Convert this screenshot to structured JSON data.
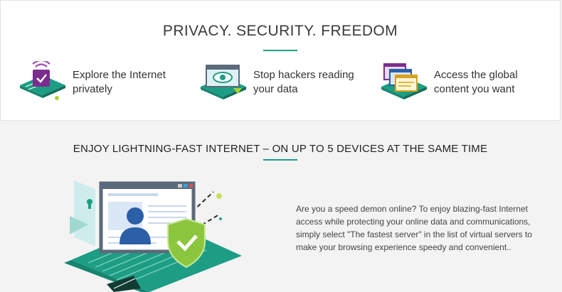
{
  "privacy_section": {
    "heading": "PRIVACY. SECURITY. FREEDOM",
    "features": [
      {
        "icon": "wifi-shield-laptop-icon",
        "text": "Explore the Internet privately"
      },
      {
        "icon": "eye-monitor-icon",
        "text": "Stop hackers reading your data"
      },
      {
        "icon": "stacked-windows-icon",
        "text": "Access the global content you want"
      }
    ]
  },
  "speed_section": {
    "heading": "ENJOY LIGHTNING-FAST INTERNET – ON UP TO 5 DEVICES AT THE SAME TIME",
    "description": "Are you a speed demon online? To enjoy blazing-fast Internet access while protecting your online data and communications, simply select \"The fastest server\" in the list of virtual servers to make your browsing experience speedy and convenient..",
    "illustration": "browser-profile-shield-illustration"
  },
  "colors": {
    "accent_green": "#1d9e84",
    "dark_green": "#17856f",
    "purple": "#7b2d8e",
    "lime": "#a8d13b",
    "profile_blue": "#2b5fa8"
  }
}
